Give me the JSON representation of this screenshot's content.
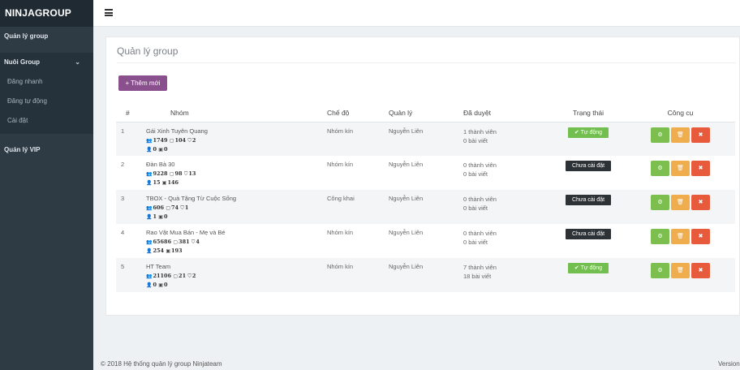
{
  "brand": "NINJAGROUP",
  "sidebar": {
    "item1": "Quản lý group",
    "group": "Nuôi Group",
    "sub": [
      "Đăng nhanh",
      "Đăng tự động",
      "Cài đặt"
    ],
    "vip": "Quản lý VIP"
  },
  "page": {
    "title": "Quản lý group",
    "add_button": "+ Thêm mới"
  },
  "table": {
    "headers": [
      "#",
      "Nhóm",
      "Chế độ",
      "Quản lý",
      "Đã duyệt",
      "Trạng thái",
      "Công cụ"
    ],
    "rows": [
      {
        "num": "1",
        "name": "Gái Xinh Tuyên Quang",
        "members": "1749",
        "posts": "104",
        "admins": "2",
        "users": "0",
        "images": "0",
        "mode": "Nhóm kín",
        "admin": "Nguyễn Liên",
        "appr_members": "1 thành viên",
        "appr_posts": "0 bài viết",
        "status": "Tự động"
      },
      {
        "num": "2",
        "name": "Đàn Bà 30",
        "members": "9228",
        "posts": "98",
        "admins": "13",
        "users": "15",
        "images": "146",
        "mode": "Nhóm kín",
        "admin": "Nguyễn Liên",
        "appr_members": "0 thành viên",
        "appr_posts": "0 bài viết",
        "status": "Chưa cài đặt"
      },
      {
        "num": "3",
        "name": "TBOX - Quà Tặng Từ Cuộc Sống",
        "members": "606",
        "posts": "74",
        "admins": "1",
        "users": "1",
        "images": "0",
        "mode": "Công khai",
        "admin": "Nguyễn Liên",
        "appr_members": "0 thành viên",
        "appr_posts": "0 bài viết",
        "status": "Chưa cài đặt"
      },
      {
        "num": "4",
        "name": "Rao Vặt Mua Bán - Mẹ và Bé",
        "members": "65686",
        "posts": "381",
        "admins": "4",
        "users": "254",
        "images": "193",
        "mode": "Nhóm kín",
        "admin": "Nguyễn Liên",
        "appr_members": "0 thành viên",
        "appr_posts": "0 bài viết",
        "status": "Chưa cài đặt"
      },
      {
        "num": "5",
        "name": "HT Team",
        "members": "21106",
        "posts": "21",
        "admins": "2",
        "users": "0",
        "images": "0",
        "mode": "Nhóm kín",
        "admin": "Nguyễn Liên",
        "appr_members": "7 thành viên",
        "appr_posts": "18 bài viết",
        "status": "Tự động"
      }
    ]
  },
  "icons": {
    "members": "users-icon",
    "posts": "comment-icon",
    "admins": "shield-icon",
    "users": "user-icon",
    "images": "image-icon",
    "settings": "gear-icon",
    "delete": "trash-icon",
    "close": "times-icon",
    "check": "check-circle-icon"
  },
  "colors": {
    "sidebar": "#2e3a44",
    "add_button": "#8a4f8d",
    "status_auto": "#72be4f",
    "status_unset": "#2d3237",
    "tool_green": "#7cbf4f",
    "tool_orange": "#f0ad4e",
    "tool_red": "#e85a3c"
  },
  "footer": {
    "copyright": "© 2018 Hệ thống quản lý group Ninjateam",
    "version": "Version"
  }
}
